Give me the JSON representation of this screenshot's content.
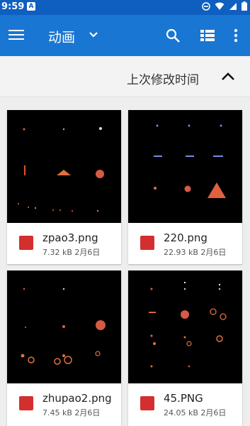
{
  "status": {
    "time": "9:59",
    "app_icon": "A"
  },
  "appbar": {
    "title": "动画"
  },
  "sort": {
    "label": "上次修改时间"
  },
  "files": [
    {
      "name": "zpao3.png",
      "size": "7.32 kB",
      "date": "2月6日"
    },
    {
      "name": "220.png",
      "size": "22.93 kB",
      "date": "2月6日"
    },
    {
      "name": "zhupao2.png",
      "size": "7.45 kB",
      "date": "2月6日"
    },
    {
      "name": "45.PNG",
      "size": "24.05 kB",
      "date": "2月6日"
    }
  ],
  "colors": {
    "status_bar": "#0e5fbf",
    "app_bar": "#1976d2",
    "file_icon": "#d32f2f"
  }
}
